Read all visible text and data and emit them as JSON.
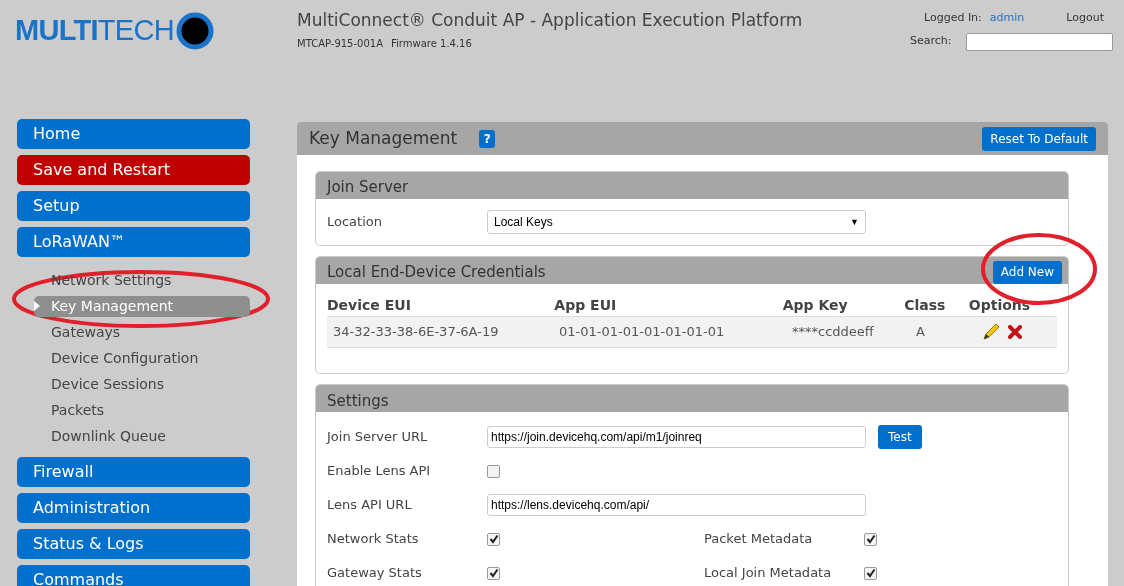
{
  "header": {
    "logo": "**MULTI**TECH",
    "title": "MultiConnect® Conduit AP - Application Execution Platform",
    "model": "MTCAP-915-001A",
    "firmware": "Firmware 1.4.16",
    "logged_in_label": "Logged In:",
    "user": "admin",
    "logout": "Logout",
    "search_label": "Search:"
  },
  "sidebar": [
    {
      "label": "Home",
      "color": "#0070cc"
    },
    {
      "label": "Save and Restart",
      "color": "#c00000"
    },
    {
      "label": "Setup",
      "color": "#0070cc"
    },
    {
      "label": "LoRaWAN™",
      "color": "#0070cc",
      "children": [
        {
          "label": "Network Settings",
          "selected": false
        },
        {
          "label": "Key Management",
          "selected": true
        },
        {
          "label": "Gateways",
          "selected": false
        },
        {
          "label": "Device Configuration",
          "selected": false
        },
        {
          "label": "Device Sessions",
          "selected": false
        },
        {
          "label": "Packets",
          "selected": false
        },
        {
          "label": "Downlink Queue",
          "selected": false
        }
      ]
    },
    {
      "label": "Firewall",
      "color": "#0070cc"
    },
    {
      "label": "Administration",
      "color": "#0070cc"
    },
    {
      "label": "Status & Logs",
      "color": "#0070cc"
    },
    {
      "label": "Commands",
      "color": "#0070cc"
    }
  ],
  "page": {
    "title": "Key Management",
    "help": "?",
    "reset_button": "Reset To Default"
  },
  "join_server": {
    "title": "Join Server",
    "location_label": "Location",
    "location_value": "Local Keys",
    "location_arrow": "▼"
  },
  "credentials": {
    "title": "Local End-Device Credentials",
    "add_button": "Add New",
    "columns": [
      "Device EUI",
      "App EUI",
      "App Key",
      "Class",
      "Options"
    ],
    "rows": [
      {
        "device_eui": "34-32-33-38-6E-37-6A-19",
        "app_eui": "01-01-01-01-01-01-01-01",
        "app_key": "****ccddeeff",
        "class": "A"
      }
    ]
  },
  "settings": {
    "title": "Settings",
    "rows": [
      {
        "kind": "url",
        "label": "Join Server URL",
        "value": "https://join.devicehq.com/api/m1/joinreq",
        "button": "Test"
      },
      {
        "kind": "check",
        "label": "Enable Lens API",
        "checked": false
      },
      {
        "kind": "url",
        "label": "Lens API URL",
        "value": "https://lens.devicehq.com/api/"
      },
      {
        "kind": "pair",
        "label": "Network Stats",
        "checked": true,
        "label_2": "Packet Metadata",
        "checked_2": true
      },
      {
        "kind": "pair",
        "label": "Gateway Stats",
        "checked": true,
        "label_2": "Local Join Metadata",
        "checked_2": true
      }
    ]
  }
}
